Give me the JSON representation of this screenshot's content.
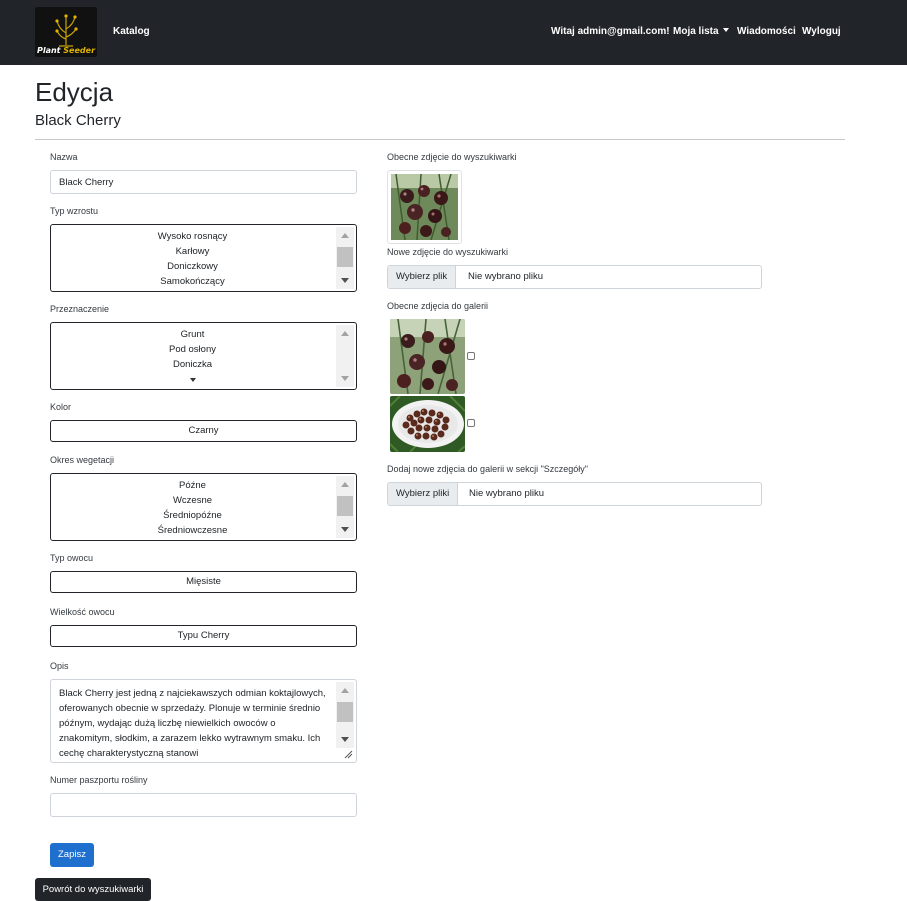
{
  "navbar": {
    "logo_text_1": "Plant",
    "logo_text_2": "Seeder",
    "catalog": "Katalog",
    "welcome": "Witaj admin@gmail.com!",
    "my_list": "Moja lista",
    "messages": "Wiadomości",
    "logout": "Wyloguj"
  },
  "page": {
    "title": "Edycja",
    "subtitle": "Black Cherry"
  },
  "form": {
    "name": {
      "label": "Nazwa",
      "value": "Black Cherry"
    },
    "growth_type": {
      "label": "Typ wzrostu",
      "options": [
        "Wysoko rosnący",
        "Karłowy",
        "Doniczkowy",
        "Samokończący"
      ]
    },
    "purpose": {
      "label": "Przeznaczenie",
      "options": [
        "Grunt",
        "Pod osłony",
        "Doniczka"
      ]
    },
    "color": {
      "label": "Kolor",
      "value": "Czarny"
    },
    "season": {
      "label": "Okres wegetacji",
      "options": [
        "Późne",
        "Wczesne",
        "Średniopóźne",
        "Średniowczesne"
      ]
    },
    "fruit_type": {
      "label": "Typ owocu",
      "value": "Mięsiste"
    },
    "fruit_size": {
      "label": "Wielkość owocu",
      "value": "Typu Cherry"
    },
    "description": {
      "label": "Opis",
      "value": "Black Cherry jest jedną z najciekawszych odmian koktajlowych, oferowanych obecnie w sprzedaży. Plonuje w terminie średnio późnym, wydając dużą liczbę niewielkich owoców o znakomitym, słodkim, a zarazem lekko wytrawnym smaku. Ich cechę charakterystyczną stanowi"
    },
    "passport": {
      "label": "Numer paszportu rośliny",
      "value": ""
    },
    "save": "Zapisz",
    "back": "Powrót do wyszukiwarki"
  },
  "right": {
    "current_search_photo_label": "Obecne zdjęcie do wyszukiwarki",
    "new_search_photo_label": "Nowe zdjęcie do wyszukiwarki",
    "file_button_1": "Wybierz plik",
    "file_status_1": "Nie wybrano pliku",
    "gallery_label": "Obecne zdjęcia do galerii",
    "add_gallery_label": "Dodaj nowe zdjęcia do galerii w sekcji \"Szczegóły\"",
    "file_button_2": "Wybierz pliki",
    "file_status_2": "Nie wybrano pliku"
  },
  "colors": {
    "navbar": "#212529",
    "primary": "#1f6fce",
    "logo_accent": "#e0b400"
  }
}
